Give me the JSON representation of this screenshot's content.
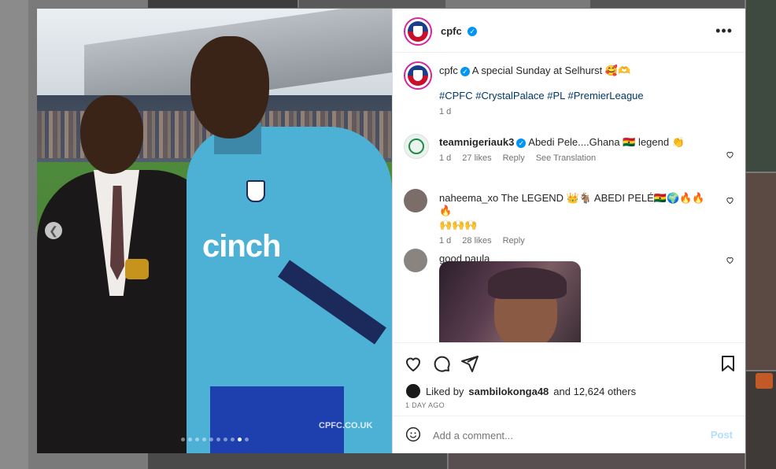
{
  "post": {
    "username": "cpfc",
    "watermark": "CPFC.CO.UK",
    "sponsor_text": "cinch",
    "caption_text": "A special Sunday at Selhurst 🥰🫶",
    "hashtags": "#CPFC #CrystalPalace #PL #PremierLeague",
    "caption_time": "1 d",
    "slides_total": 10,
    "slide_active": 9
  },
  "comments": [
    {
      "user": "teamnigeriauk3",
      "verified": true,
      "text": "Abedi Pele....Ghana 🇬🇭 legend 👏",
      "time": "1 d",
      "likes": "27 likes",
      "reply": "Reply",
      "translate": "See Translation"
    },
    {
      "user": "naheema_xo",
      "text": "The LEGEND 👑🐐 ABEDI PELÉ🇬🇭🌍🔥🔥🔥",
      "text2": "🙌🙌🙌",
      "time": "1 d",
      "likes": "28 likes",
      "reply": "Reply"
    },
    {
      "user": "good.paula"
    }
  ],
  "actions": {
    "liked_prefix": "Liked by",
    "liked_user": "sambilokonga48",
    "liked_rest": "and 12,624 others",
    "timestamp": "1 DAY AGO"
  },
  "comment_box": {
    "placeholder": "Add a comment...",
    "post_label": "Post"
  },
  "colors": {
    "verified": "#0095f6",
    "link": "#00376b",
    "kit_blue": "#4db1d6"
  }
}
